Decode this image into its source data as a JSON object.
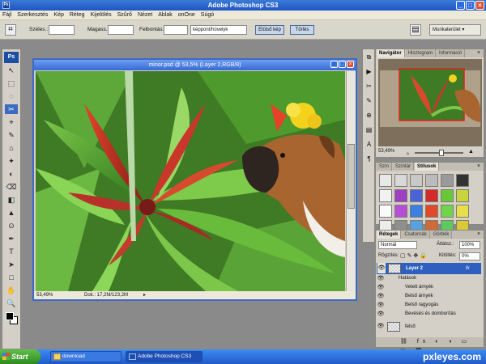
{
  "app": {
    "title": "Adobe Photoshop CS3",
    "win_controls": [
      "_",
      "□",
      "×"
    ]
  },
  "menu": [
    "Fájl",
    "Szerkesztés",
    "Kép",
    "Réteg",
    "Kijelölés",
    "Szűrő",
    "Nézet",
    "Ablak",
    "onOne",
    "Súgó"
  ],
  "options": {
    "width_label": "Széles.:",
    "height_label": "Magass.:",
    "resolution_label": "Felbontás:",
    "unit_select": "képpont/hüvelyk",
    "front_image_btn": "Elülső kép",
    "clear_btn": "Törlés",
    "workspace": "Munkaterület ▾"
  },
  "tools": {
    "logo": "Ps",
    "icons": [
      "↖",
      "⬚",
      "◌",
      "✂",
      "⌖",
      "✎",
      "⌂",
      "✦",
      "◐",
      "⌫",
      "◧",
      "▲",
      "⊙",
      "✒",
      "T",
      "➤",
      "□",
      "✋",
      "🔍"
    ]
  },
  "document": {
    "title": "minor.psd @ 53,5% (Layer 2,RGB/8)",
    "zoom": "53,49%",
    "doc_info": "Dok.: 17,2M/123,2M"
  },
  "navigator": {
    "tabs": [
      "Navigátor",
      "Hisztogram",
      "Információ"
    ],
    "zoom": "53,49%"
  },
  "styles_panel": {
    "tabs": [
      "Szín",
      "Színtár",
      "Stílusok"
    ],
    "swatches": [
      "#e8e8e8",
      "#d8d8d8",
      "#c8c8c8",
      "#bbbbbb",
      "#9a9a9a",
      "#333333",
      "#f2f2f2",
      "#9d3fc0",
      "#4a63d6",
      "#d12b2b",
      "#67c93a",
      "#c8d43e",
      "#fafafa",
      "#b64fd6",
      "#3b7fe0",
      "#e04a2a",
      "#72d44a",
      "#e8e04a",
      "#ececec",
      "#8f8f8f",
      "#5aa0e0",
      "#d06a3a",
      "#5fc85f",
      "#d8c83a"
    ]
  },
  "layers": {
    "tabs": [
      "Rétegek",
      "Csatornák",
      "Görbék"
    ],
    "blend_mode": "Normál",
    "opacity_label": "Átlátsz.:",
    "opacity_value": "100%",
    "lock_label": "Rögzítés:",
    "fill_label": "Kitöltés:",
    "fill_value": "0%",
    "rows": [
      {
        "name": "Layer 2",
        "fx": "fx"
      },
      {
        "name": "Hatások"
      },
      {
        "name": "Vetett árnyék"
      },
      {
        "name": "Belső árnyék"
      },
      {
        "name": "Belső ragyogás"
      },
      {
        "name": "Bevésés és domborítás"
      },
      {
        "name": "felső"
      }
    ]
  },
  "taskbar": {
    "start": "Start",
    "items": [
      "download",
      "Adobe Photoshop CS3"
    ],
    "watermark": "pxleyes.com"
  }
}
